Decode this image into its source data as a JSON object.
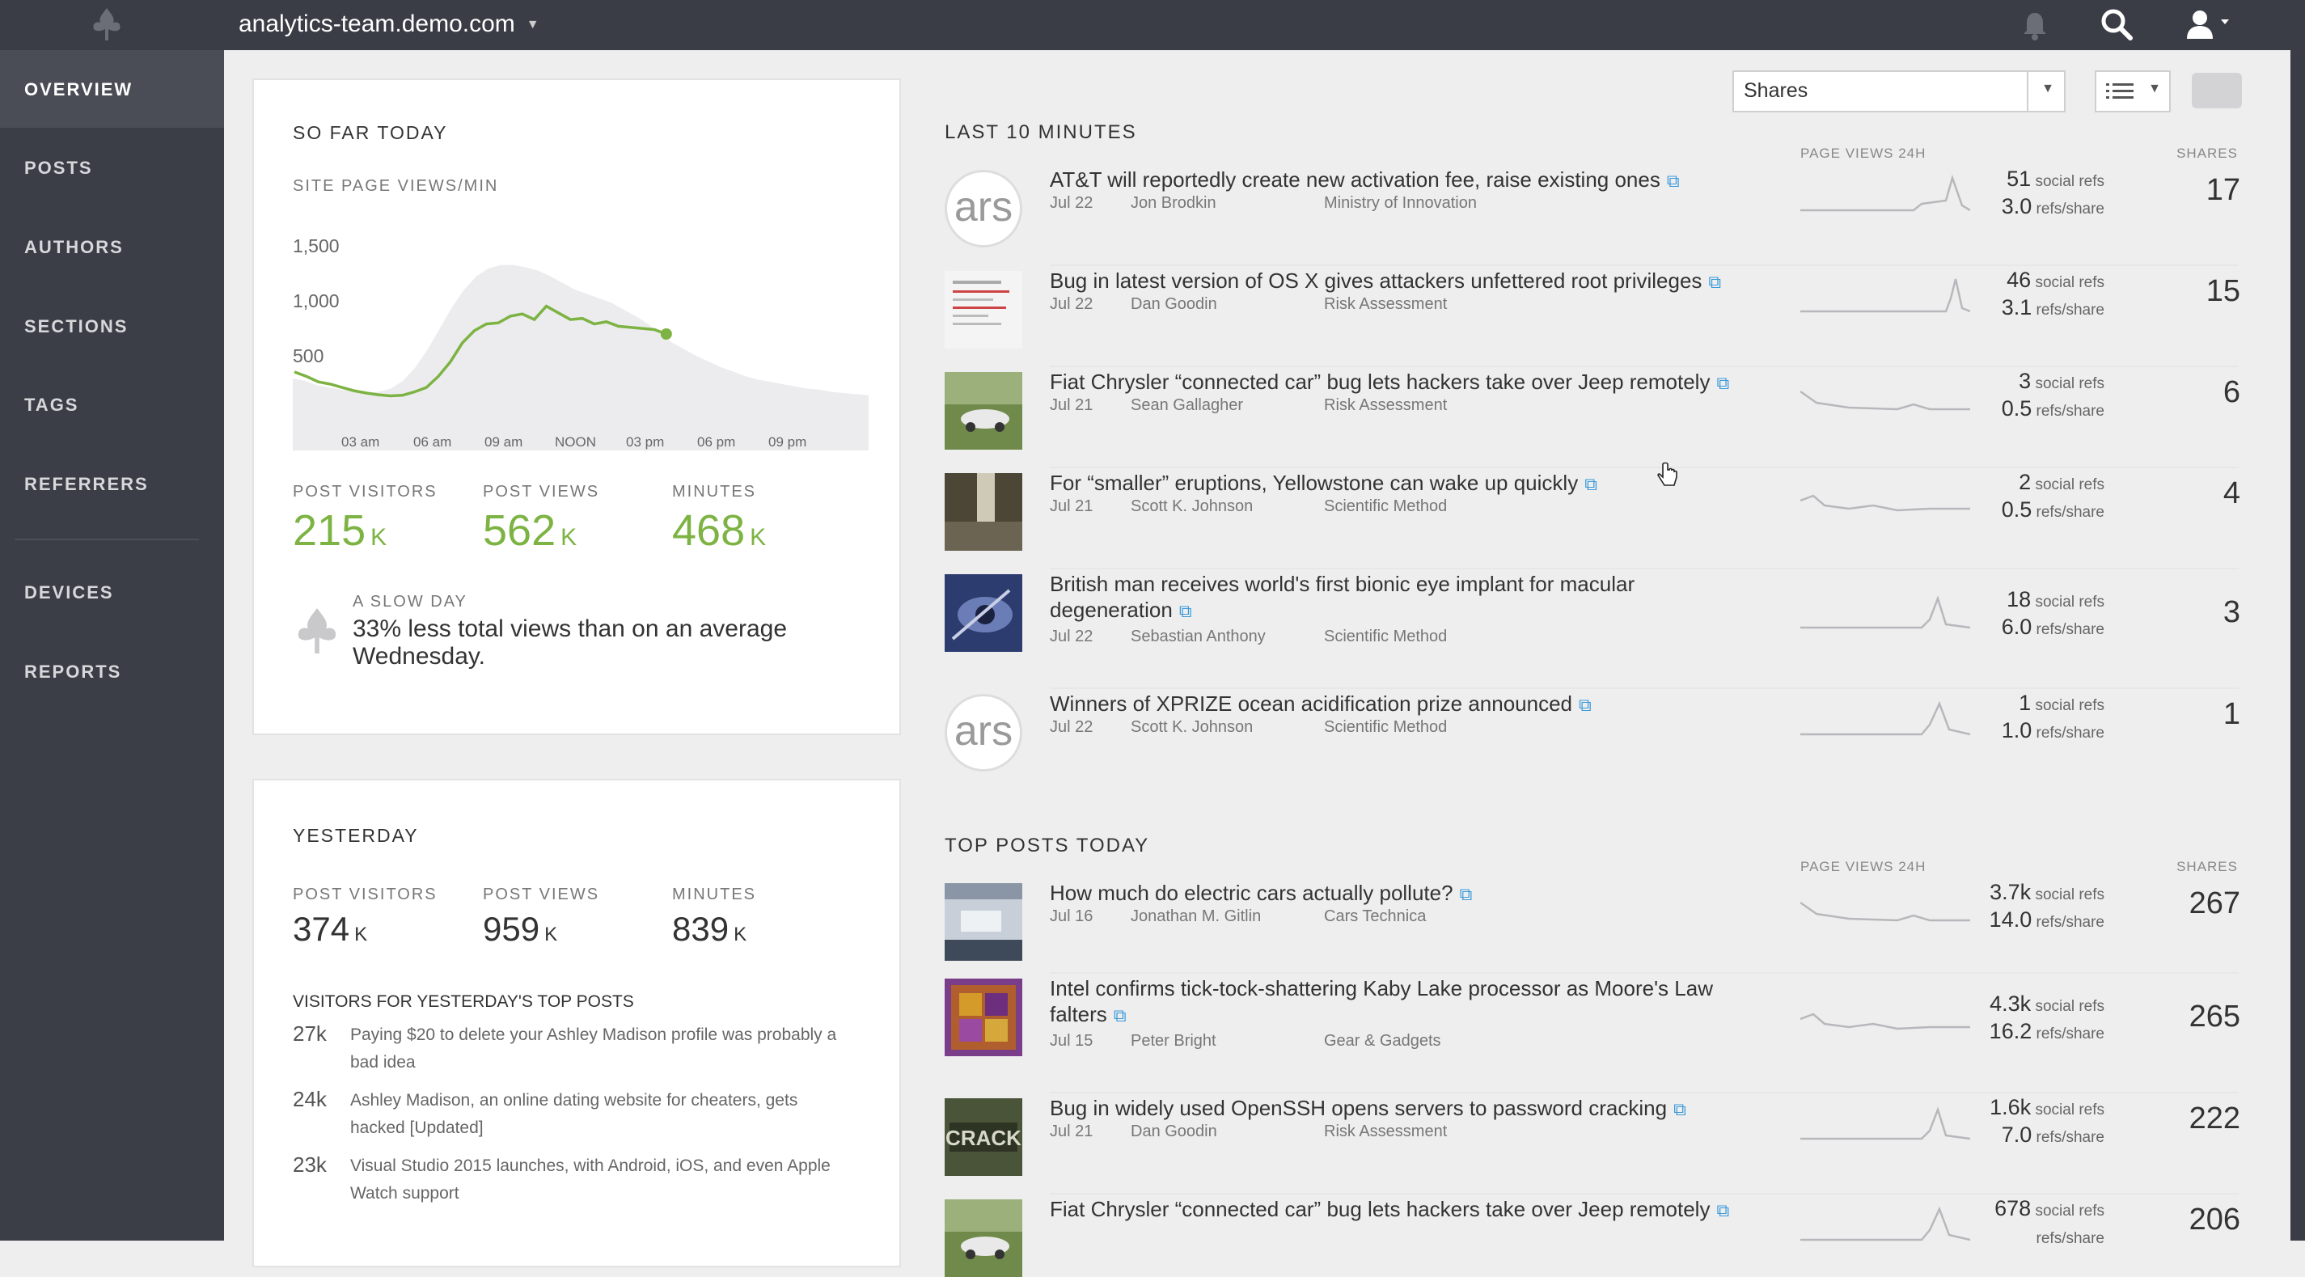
{
  "app": {
    "site": "analytics-team.demo.com"
  },
  "sidebar": {
    "items": [
      {
        "label": "OVERVIEW"
      },
      {
        "label": "POSTS"
      },
      {
        "label": "AUTHORS"
      },
      {
        "label": "SECTIONS"
      },
      {
        "label": "TAGS"
      },
      {
        "label": "REFERRERS"
      },
      {
        "label": "DEVICES"
      },
      {
        "label": "REPORTS"
      }
    ]
  },
  "toolbar": {
    "sort_value": "Shares"
  },
  "today": {
    "title": "SO FAR TODAY",
    "chart_label": "SITE PAGE VIEWS/MIN",
    "stats": [
      {
        "label": "POST VISITORS",
        "value": "215",
        "unit": "K"
      },
      {
        "label": "POST VIEWS",
        "value": "562",
        "unit": "K"
      },
      {
        "label": "MINUTES",
        "value": "468",
        "unit": "K"
      }
    ],
    "note_title": "A SLOW DAY",
    "note_text": "33% less total views than on an average Wednesday."
  },
  "chart_data": {
    "type": "area",
    "yticks": [
      "1,500",
      "1,000",
      "500"
    ],
    "xticks": [
      "03 am",
      "06 am",
      "09 am",
      "NOON",
      "03 pm",
      "06 pm",
      "09 pm"
    ],
    "ylim": [
      0,
      1800
    ],
    "x_hours": [
      0,
      0.5,
      1,
      1.5,
      2,
      2.5,
      3,
      3.5,
      4,
      4.5,
      5,
      5.5,
      6,
      6.5,
      7,
      7.5,
      8,
      8.5,
      9,
      9.5,
      10,
      10.5,
      11,
      11.5,
      12,
      12.5,
      13,
      13.5,
      14,
      14.5,
      15,
      15.5
    ],
    "today_series": [
      560,
      520,
      470,
      450,
      420,
      390,
      370,
      355,
      345,
      350,
      380,
      420,
      520,
      650,
      820,
      930,
      990,
      1000,
      1060,
      1080,
      1030,
      1150,
      1090,
      1030,
      1040,
      990,
      1010,
      970,
      960,
      950,
      940,
      900
    ],
    "average_series": [
      500,
      480,
      440,
      420,
      400,
      380,
      370,
      380,
      410,
      480,
      600,
      760,
      950,
      1140,
      1300,
      1420,
      1490,
      1520,
      1520,
      1500,
      1470,
      1420,
      1360,
      1300,
      1260,
      1220,
      1180,
      1120,
      1060,
      990,
      900,
      820,
      760,
      700,
      650,
      600,
      560,
      520,
      490,
      470,
      450,
      430,
      410,
      400,
      380,
      370,
      360,
      350
    ]
  },
  "yesterday": {
    "title": "YESTERDAY",
    "stats": [
      {
        "label": "POST VISITORS",
        "value": "374",
        "unit": "K"
      },
      {
        "label": "POST VIEWS",
        "value": "959",
        "unit": "K"
      },
      {
        "label": "MINUTES",
        "value": "839",
        "unit": "K"
      }
    ],
    "top_title": "VISITORS FOR YESTERDAY'S TOP POSTS",
    "top_posts": [
      {
        "count": "27k",
        "line1": "Paying $20 to delete your Ashley Madison profile was probably a",
        "line2": "bad idea"
      },
      {
        "count": "24k",
        "line1": "Ashley Madison, an online dating website for cheaters, gets",
        "line2": "hacked [Updated]"
      },
      {
        "count": "23k",
        "line1": "Visual Studio 2015 launches, with Android, iOS, and even Apple",
        "line2": "Watch support"
      }
    ]
  },
  "columns": {
    "pageviews": "PAGE VIEWS 24H",
    "shares": "SHARES",
    "social_refs": "social refs",
    "refs_share": "refs/share"
  },
  "last10": {
    "title": "LAST 10 MINUTES",
    "posts": [
      {
        "line1": "AT&T will reportedly create new activation fee, raise existing ones",
        "line2": "",
        "date": "Jul 22",
        "author": "Jon Brodkin",
        "section": "Ministry of Innovation",
        "refs": "51",
        "refs_share": "3.0",
        "shares": "17",
        "thumb": "ars"
      },
      {
        "line1": "Bug in latest version of OS X gives attackers unfettered root privileges",
        "line2": "",
        "date": "Jul 22",
        "author": "Dan Goodin",
        "section": "Risk Assessment",
        "refs": "46",
        "refs_share": "3.1",
        "shares": "15",
        "thumb": "doc"
      },
      {
        "line1": "Fiat Chrysler “connected car” bug lets hackers take over Jeep remotely",
        "line2": "",
        "date": "Jul 21",
        "author": "Sean Gallagher",
        "section": "Risk Assessment",
        "refs": "3",
        "refs_share": "0.5",
        "shares": "6",
        "thumb": "car"
      },
      {
        "line1": "For “smaller” eruptions, Yellowstone can wake up quickly",
        "line2": "",
        "date": "Jul 21",
        "author": "Scott K. Johnson",
        "section": "Scientific Method",
        "refs": "2",
        "refs_share": "0.5",
        "shares": "4",
        "thumb": "falls"
      },
      {
        "line1": "British man receives world's first bionic eye implant for macular",
        "line2": "degeneration",
        "date": "Jul 22",
        "author": "Sebastian Anthony",
        "section": "Scientific Method",
        "refs": "18",
        "refs_share": "6.0",
        "shares": "3",
        "thumb": "eye"
      },
      {
        "line1": "Winners of XPRIZE ocean acidification prize announced",
        "line2": "",
        "date": "Jul 22",
        "author": "Scott K. Johnson",
        "section": "Scientific Method",
        "refs": "1",
        "refs_share": "1.0",
        "shares": "1",
        "thumb": "ars"
      }
    ]
  },
  "toptoday": {
    "title": "TOP POSTS TODAY",
    "posts": [
      {
        "line1": "How much do electric cars actually pollute?",
        "line2": "",
        "date": "Jul 16",
        "author": "Jonathan M. Gitlin",
        "section": "Cars Technica",
        "refs": "3.7k",
        "refs_share": "14.0",
        "shares": "267",
        "thumb": "city"
      },
      {
        "line1": "Intel confirms tick-tock-shattering Kaby Lake processor as Moore's Law",
        "line2": "falters",
        "date": "Jul 15",
        "author": "Peter Bright",
        "section": "Gear & Gadgets",
        "refs": "4.3k",
        "refs_share": "16.2",
        "shares": "265",
        "thumb": "chip"
      },
      {
        "line1": "Bug in widely used OpenSSH opens servers to password cracking",
        "line2": "",
        "date": "Jul 21",
        "author": "Dan Goodin",
        "section": "Risk Assessment",
        "refs": "1.6k",
        "refs_share": "7.0",
        "shares": "222",
        "thumb": "crack"
      },
      {
        "line1": "Fiat Chrysler “connected car” bug lets hackers take over Jeep remotely",
        "line2": "",
        "date": "",
        "author": "",
        "section": "",
        "refs": "678",
        "refs_share": "",
        "shares": "206",
        "thumb": "car"
      }
    ]
  }
}
